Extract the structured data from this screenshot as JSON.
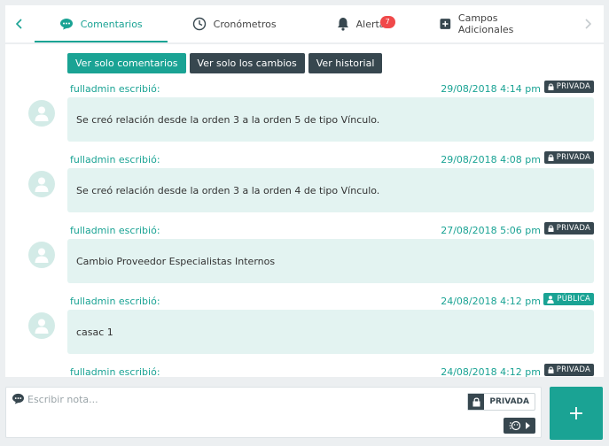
{
  "tabs": [
    {
      "label": "Comentarios",
      "icon": "comment-icon",
      "active": true
    },
    {
      "label": "Cronómetros",
      "icon": "clock-icon",
      "active": false
    },
    {
      "label": "Alertas",
      "icon": "bell-icon",
      "active": false,
      "badge": "7"
    },
    {
      "label": "Campos Adicionales",
      "icon": "plus-square-icon",
      "active": false
    }
  ],
  "filters": {
    "comments": "Ver solo comentarios",
    "changes": "Ver solo los cambios",
    "history": "Ver historial"
  },
  "entries": [
    {
      "author": "fulladmin escribió:",
      "date": "29/08/2018 4:14 pm",
      "visibility": "PRIVADA",
      "text": "Se creó relación desde la orden 3 a la orden 5 de tipo Vínculo."
    },
    {
      "author": "fulladmin escribió:",
      "date": "29/08/2018 4:08 pm",
      "visibility": "PRIVADA",
      "text": "Se creó relación desde la orden 3 a la orden 4 de tipo Vínculo."
    },
    {
      "author": "fulladmin escribió:",
      "date": "27/08/2018 5:06 pm",
      "visibility": "PRIVADA",
      "text": "Cambio Proveedor Especialistas Internos"
    },
    {
      "author": "fulladmin escribió:",
      "date": "24/08/2018 4:12 pm",
      "visibility": "PÚBLICA",
      "text": "casac 1"
    },
    {
      "author": "fulladmin escribió:",
      "date": "24/08/2018 4:12 pm",
      "visibility": "PRIVADA",
      "text": ""
    }
  ],
  "note": {
    "placeholder": "Escribir nota...",
    "value": "",
    "privacy_label": "PRIVADA"
  },
  "add_button": "+",
  "colors": {
    "accent": "#1aa394",
    "dark": "#37474f",
    "badge": "#f0494a",
    "bubble": "#e3f3f1"
  }
}
